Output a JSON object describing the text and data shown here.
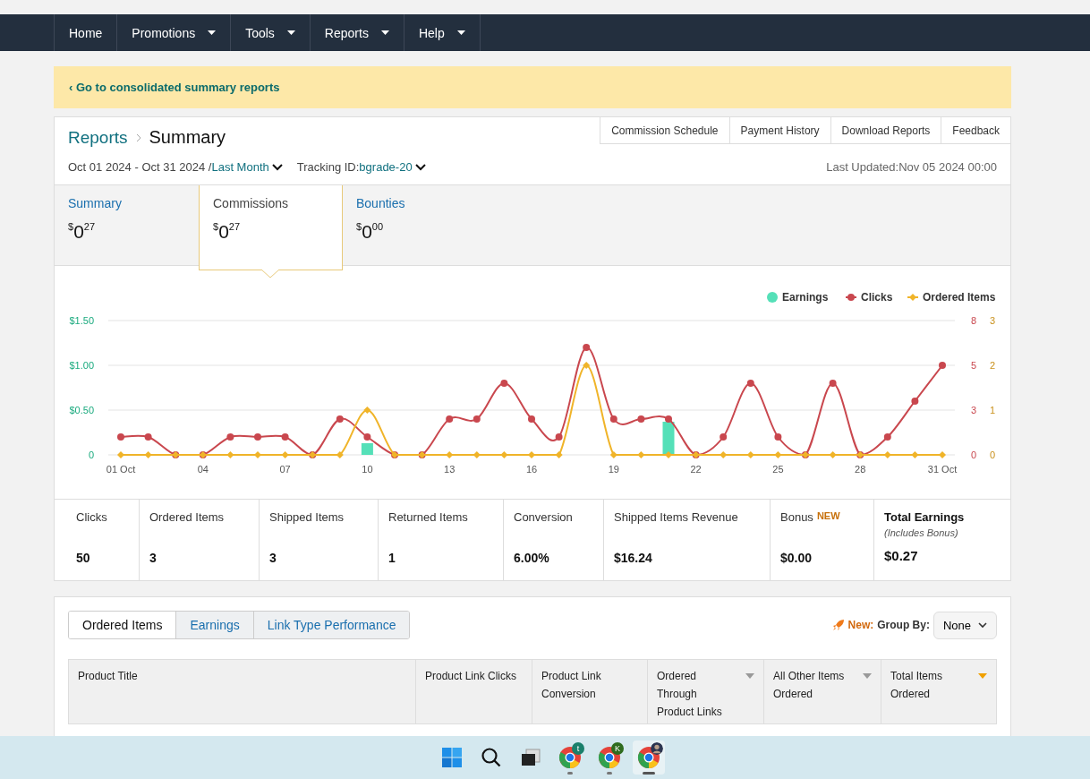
{
  "nav": [
    {
      "label": "Home",
      "dropdown": false
    },
    {
      "label": "Promotions",
      "dropdown": true
    },
    {
      "label": "Tools",
      "dropdown": true
    },
    {
      "label": "Reports",
      "dropdown": true
    },
    {
      "label": "Help",
      "dropdown": true
    }
  ],
  "banner": {
    "link": "‹ Go to consolidated summary reports"
  },
  "header": {
    "breadcrumb": "Reports",
    "title": "Summary",
    "links": [
      "Commission Schedule",
      "Payment History",
      "Download Reports",
      "Feedback"
    ],
    "date_range": "Oct 01 2024 - Oct 31 2024 /",
    "period": "Last Month",
    "tracking_label": "Tracking ID:",
    "tracking_id": "bgrade-20",
    "last_updated": "Last Updated:Nov 05 2024 00:00"
  },
  "summary_tabs": [
    {
      "label": "Summary",
      "currency": "$",
      "whole": "0",
      "cents": "27",
      "selected": false
    },
    {
      "label": "Commissions",
      "currency": "$",
      "whole": "0",
      "cents": "27",
      "selected": true
    },
    {
      "label": "Bounties",
      "currency": "$",
      "whole": "0",
      "cents": "00",
      "selected": false
    }
  ],
  "chart_data": {
    "type": "line",
    "categories": [
      "01 Oct",
      null,
      null,
      "04",
      null,
      null,
      "07",
      null,
      null,
      "10",
      null,
      null,
      "13",
      null,
      null,
      "16",
      null,
      null,
      "19",
      null,
      null,
      "22",
      null,
      null,
      "25",
      null,
      null,
      "28",
      null,
      null,
      "31 Oct"
    ],
    "yticks": [
      {
        "value": 0,
        "label": "0"
      },
      {
        "value": 0.5,
        "label": "$0.50"
      },
      {
        "value": 1,
        "label": "$1.00"
      },
      {
        "value": 1.5,
        "label": "$1.50"
      }
    ],
    "legend": "top-right",
    "ylim": [
      0,
      1.5
    ],
    "y2lim": [
      0,
      7.5
    ],
    "y2ticks": [
      {
        "value": 0,
        "label": "0"
      },
      {
        "value": 2.5,
        "label": "3"
      },
      {
        "value": 5,
        "label": "5"
      },
      {
        "value": 7.5,
        "label": "8"
      }
    ],
    "y3lim": [
      0,
      3
    ],
    "y3ticks": [
      0,
      1,
      2,
      3
    ],
    "series": [
      {
        "name": "Earnings",
        "type": "bar",
        "color": "#55e0b8",
        "values": [
          0,
          0,
          0,
          0,
          0,
          0,
          0,
          0,
          0,
          0.13,
          0,
          0,
          0,
          0,
          0,
          0,
          0,
          0,
          0,
          0,
          0.37,
          0,
          0,
          0,
          0,
          0,
          0,
          0,
          0,
          0,
          0
        ]
      },
      {
        "name": "Clicks",
        "type": "line",
        "marker": "circle",
        "axis": "y2",
        "color": "#c9474e",
        "values": [
          1,
          1,
          0,
          0,
          1,
          1,
          1,
          0,
          2,
          1,
          0,
          0,
          2,
          2,
          4,
          2,
          1,
          6,
          2,
          2,
          2,
          0,
          1,
          4,
          1,
          0,
          4,
          0,
          1,
          3,
          5
        ]
      },
      {
        "name": "Ordered Items",
        "type": "line",
        "marker": "diamond",
        "axis": "y3",
        "color": "#f0b429",
        "values": [
          0,
          0,
          0,
          0,
          0,
          0,
          0,
          0,
          0,
          1,
          0,
          0,
          0,
          0,
          0,
          0,
          0,
          2,
          0,
          0,
          0,
          0,
          0,
          0,
          0,
          0,
          0,
          0,
          0,
          0,
          0
        ]
      }
    ]
  },
  "stats": [
    {
      "label": "Clicks",
      "value": "50",
      "emphasis": false
    },
    {
      "label": "Ordered Items",
      "value": "3",
      "emphasis": false
    },
    {
      "label": "Shipped Items",
      "value": "3",
      "emphasis": false
    },
    {
      "label": "Returned Items",
      "value": "1",
      "emphasis": false
    },
    {
      "label": "Conversion",
      "value": "6.00%",
      "emphasis": false
    },
    {
      "label": "Shipped Items Revenue",
      "value": "$16.24",
      "emphasis": false
    },
    {
      "label": "Bonus",
      "badge": "NEW",
      "value": "$0.00",
      "emphasis": false
    },
    {
      "label": "Total Earnings",
      "note": "(Includes Bonus)",
      "value": "$0.27",
      "emphasis": true
    }
  ],
  "report_tabs": [
    {
      "label": "Ordered Items",
      "selected": true
    },
    {
      "label": "Earnings",
      "selected": false
    },
    {
      "label": "Link Type Performance",
      "selected": false
    }
  ],
  "group_by": {
    "new_label": "New:",
    "label": "Group By:",
    "value": "None"
  },
  "table": {
    "columns": [
      {
        "label": "Product Title",
        "sortable": false
      },
      {
        "label": "Product Link Clicks",
        "sortable": false
      },
      {
        "label": "Product Link Conversion",
        "sortable": false
      },
      {
        "label": "Ordered Through Product Links",
        "sortable": true,
        "sorted": false
      },
      {
        "label": "All Other Items Ordered",
        "sortable": true,
        "sorted": false
      },
      {
        "label": "Total Items Ordered",
        "sortable": true,
        "sorted": true
      }
    ]
  },
  "taskbar": {
    "apps": [
      {
        "kind": "start"
      },
      {
        "kind": "search"
      },
      {
        "kind": "taskview"
      },
      {
        "kind": "browser",
        "badge": "t",
        "color": "#1a7f6b",
        "active": false
      },
      {
        "kind": "browser",
        "badge": "K",
        "color": "#2e6b1e",
        "active": false
      },
      {
        "kind": "browser",
        "avatar": true,
        "active": true
      }
    ]
  }
}
